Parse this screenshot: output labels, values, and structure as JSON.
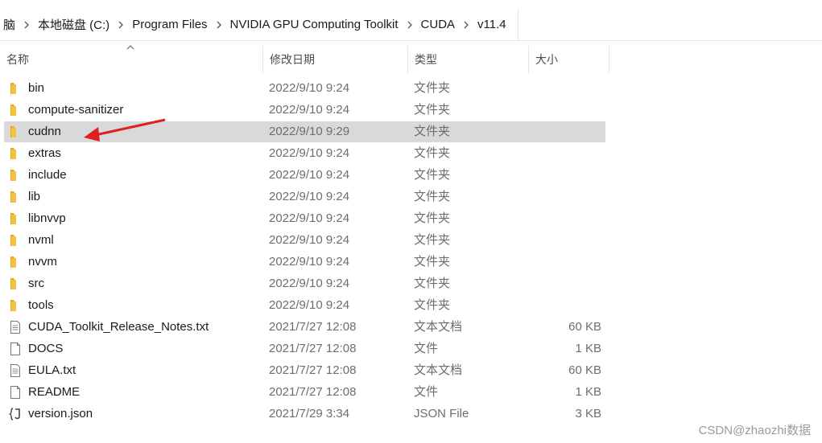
{
  "breadcrumb": {
    "items": [
      "脑",
      "本地磁盘 (C:)",
      "Program Files",
      "NVIDIA GPU Computing Toolkit",
      "CUDA",
      "v11.4"
    ]
  },
  "columns": {
    "name": "名称",
    "date": "修改日期",
    "type": "类型",
    "size": "大小"
  },
  "files": [
    {
      "name": "bin",
      "date": "2022/9/10 9:24",
      "type": "文件夹",
      "size": "",
      "icon": "folder-icon"
    },
    {
      "name": "compute-sanitizer",
      "date": "2022/9/10 9:24",
      "type": "文件夹",
      "size": "",
      "icon": "folder-icon"
    },
    {
      "name": "cudnn",
      "date": "2022/9/10 9:29",
      "type": "文件夹",
      "size": "",
      "icon": "folder-icon",
      "selected": true
    },
    {
      "name": "extras",
      "date": "2022/9/10 9:24",
      "type": "文件夹",
      "size": "",
      "icon": "folder-icon"
    },
    {
      "name": "include",
      "date": "2022/9/10 9:24",
      "type": "文件夹",
      "size": "",
      "icon": "folder-icon"
    },
    {
      "name": "lib",
      "date": "2022/9/10 9:24",
      "type": "文件夹",
      "size": "",
      "icon": "folder-icon"
    },
    {
      "name": "libnvvp",
      "date": "2022/9/10 9:24",
      "type": "文件夹",
      "size": "",
      "icon": "folder-icon"
    },
    {
      "name": "nvml",
      "date": "2022/9/10 9:24",
      "type": "文件夹",
      "size": "",
      "icon": "folder-icon"
    },
    {
      "name": "nvvm",
      "date": "2022/9/10 9:24",
      "type": "文件夹",
      "size": "",
      "icon": "folder-icon"
    },
    {
      "name": "src",
      "date": "2022/9/10 9:24",
      "type": "文件夹",
      "size": "",
      "icon": "folder-icon"
    },
    {
      "name": "tools",
      "date": "2022/9/10 9:24",
      "type": "文件夹",
      "size": "",
      "icon": "folder-icon"
    },
    {
      "name": "CUDA_Toolkit_Release_Notes.txt",
      "date": "2021/7/27 12:08",
      "type": "文本文档",
      "size": "60 KB",
      "icon": "text-file-icon"
    },
    {
      "name": "DOCS",
      "date": "2021/7/27 12:08",
      "type": "文件",
      "size": "1 KB",
      "icon": "blank-file-icon"
    },
    {
      "name": "EULA.txt",
      "date": "2021/7/27 12:08",
      "type": "文本文档",
      "size": "60 KB",
      "icon": "text-file-icon"
    },
    {
      "name": "README",
      "date": "2021/7/27 12:08",
      "type": "文件",
      "size": "1 KB",
      "icon": "blank-file-icon"
    },
    {
      "name": "version.json",
      "date": "2021/7/29 3:34",
      "type": "JSON File",
      "size": "3 KB",
      "icon": "json-file-icon"
    }
  ],
  "watermark": "CSDN@zhaozhi数据",
  "colors": {
    "selected_row": "#d9d9d9",
    "folder": "#f4c242",
    "annotation_arrow": "#e02020"
  }
}
